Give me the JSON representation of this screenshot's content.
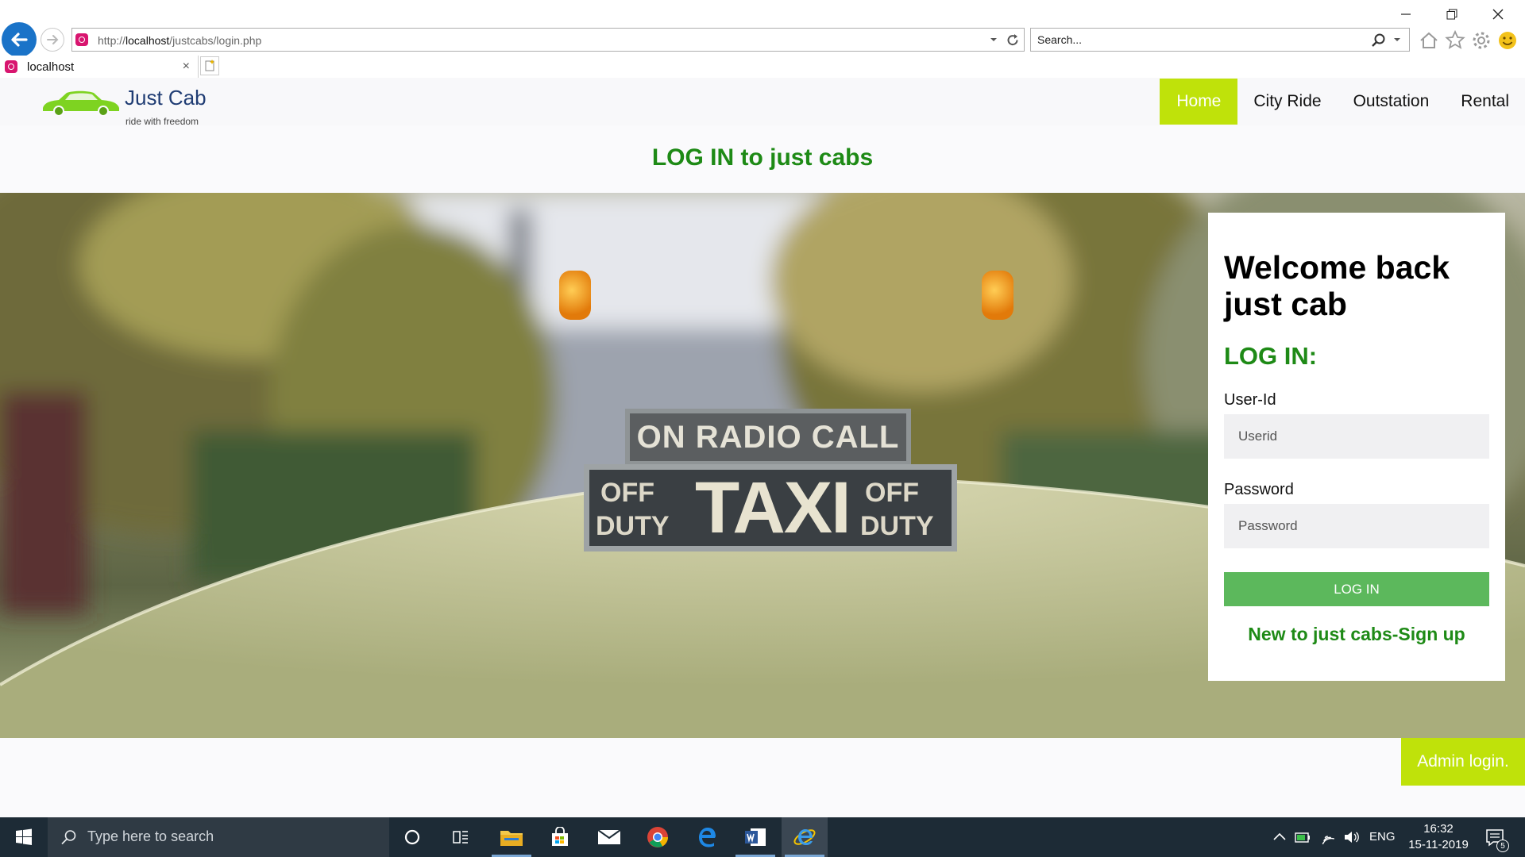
{
  "browser": {
    "url_prefix": "http://",
    "url_host": "localhost",
    "url_path": "/justcabs/login.php",
    "search_placeholder": "Search...",
    "tab_title": "localhost",
    "tab_close": "×"
  },
  "site": {
    "logo_name": "Just Cab",
    "logo_tagline": "ride with freedom",
    "nav": [
      {
        "label": "Home",
        "active": true
      },
      {
        "label": "City Ride",
        "active": false
      },
      {
        "label": "Outstation",
        "active": false
      },
      {
        "label": "Rental",
        "active": false
      }
    ],
    "page_title": "LOG IN to just cabs",
    "accent_color": "#bfe20a",
    "heading_green": "#1e8a16"
  },
  "hero": {
    "sign_top": "ON RADIO CALL",
    "sign_left_1": "OFF",
    "sign_left_2": "DUTY",
    "sign_center": "TAXI",
    "sign_right_1": "OFF",
    "sign_right_2": "DUTY"
  },
  "login": {
    "welcome": "Welcome back just cab",
    "heading": "LOG IN:",
    "userid_label": "User-Id",
    "userid_placeholder": "Userid",
    "password_label": "Password",
    "password_placeholder": "Password",
    "button_label": "LOG IN",
    "signup_link": "New to just cabs-Sign up",
    "button_color": "#5cb85c"
  },
  "admin_login": "Admin login.",
  "taskbar": {
    "search_placeholder": "Type here to search",
    "language": "ENG",
    "time": "16:32",
    "date": "15-11-2019",
    "notification_count": "5"
  }
}
